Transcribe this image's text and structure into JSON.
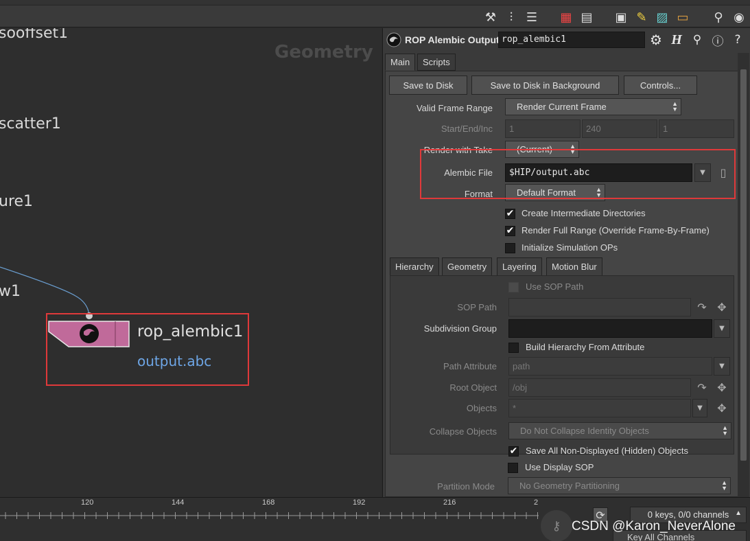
{
  "toolbar": {
    "icons": [
      "tools-icon",
      "tree-icon",
      "list-icon",
      "color-grid-icon",
      "parameter-grid-icon",
      "network-layout-icon",
      "sticky-note-icon",
      "image-add-icon",
      "box-icon",
      "zoom-icon",
      "eye-icon"
    ]
  },
  "network": {
    "context_label": "Geometry",
    "partial_nodes": [
      "sooffset1",
      "scatter1",
      "ure1",
      "w1"
    ],
    "node": {
      "name": "rop_alembic1",
      "output": "output.abc",
      "color": "#c06a9a"
    },
    "highlight_color": "#e0393a"
  },
  "params": {
    "title": "ROP Alembic Output",
    "node_name": "rop_alembic1",
    "header_icons": [
      "gear-icon",
      "help-h-icon",
      "search-icon",
      "info-icon",
      "question-icon"
    ],
    "tabs": [
      "Main",
      "Scripts"
    ],
    "buttons": {
      "save_to_disk": "Save to Disk",
      "save_bg": "Save to Disk in Background",
      "controls": "Controls..."
    },
    "valid_frame_range": {
      "label": "Valid Frame Range",
      "value": "Render Current Frame"
    },
    "start_end_inc": {
      "label": "Start/End/Inc",
      "start": "1",
      "end": "240",
      "inc": "1"
    },
    "render_with_take": {
      "label": "Render with Take",
      "value": "(Current)"
    },
    "alembic_file": {
      "label": "Alembic File",
      "value": "$HIP/output.abc"
    },
    "format": {
      "label": "Format",
      "value": "Default Format"
    },
    "checks": {
      "create_dirs": {
        "label": "Create Intermediate Directories",
        "checked": true
      },
      "render_full": {
        "label": "Render Full Range (Override Frame-By-Frame)",
        "checked": true
      },
      "init_sim": {
        "label": "Initialize Simulation OPs",
        "checked": false
      }
    },
    "subtabs": [
      "Hierarchy",
      "Geometry",
      "Layering",
      "Motion Blur"
    ],
    "hierarchy": {
      "use_sop_path": "Use SOP Path",
      "sop_path_label": "SOP Path",
      "subdiv_label": "Subdivision Group",
      "build_hier": "Build Hierarchy From Attribute",
      "path_attr_label": "Path Attribute",
      "path_attr_value": "path",
      "root_obj_label": "Root Object",
      "root_obj_value": "/obj",
      "objects_label": "Objects",
      "objects_value": "*",
      "collapse_label": "Collapse Objects",
      "collapse_value": "Do Not Collapse Identity Objects",
      "save_hidden": "Save All Non-Displayed (Hidden) Objects",
      "use_display_sop": "Use Display SOP",
      "partition_label": "Partition Mode",
      "partition_value": "No Geometry Partitioning"
    }
  },
  "timeline": {
    "ticks": [
      "120",
      "144",
      "168",
      "192",
      "216",
      "2"
    ],
    "keys": "0 keys, 0/0 channels",
    "key_all": "Key All Channels",
    "watermark": "CSDN @Karon_NeverAlone"
  }
}
